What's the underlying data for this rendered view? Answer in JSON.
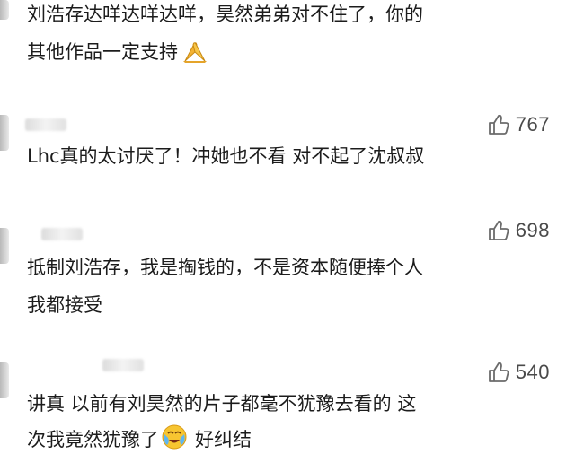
{
  "comments": [
    {
      "lines": [
        "刘浩存达咩达咩达咩，昊然弟弟对不住了，你的",
        "其他作品一定支持"
      ],
      "trailing_emoji": "praying-hands-emoji"
    },
    {
      "likes": "767",
      "lines": [
        "Lhc真的太讨厌了！冲她也不看 对不起了沈叔叔"
      ]
    },
    {
      "likes": "698",
      "lines": [
        "抵制刘浩存，我是掏钱的，不是资本随便捧个人",
        "我都接受"
      ]
    },
    {
      "likes": "540",
      "lines": [
        "讲真 以前有刘昊然的片子都毫不犹豫去看的 这",
        "次我竟然犹豫了",
        "好纠结"
      ],
      "inline_emoji": "crying-face-emoji"
    }
  ],
  "colors": {
    "text": "#1c1c1c",
    "like_icon": "#6b6b6b",
    "like_count": "#4a4a4a",
    "background": "#ffffff"
  }
}
